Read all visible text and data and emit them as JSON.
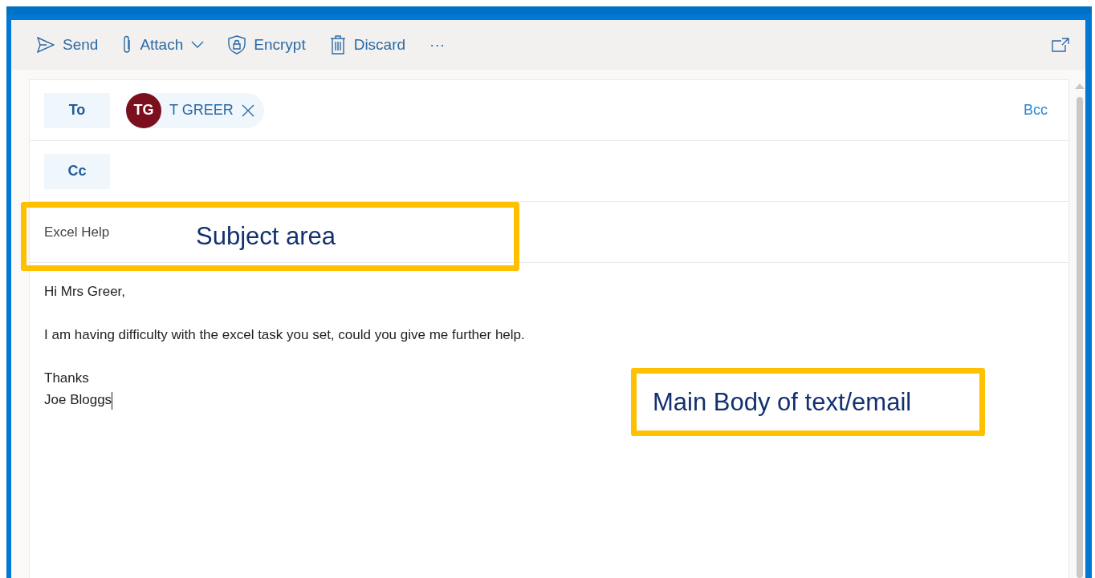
{
  "toolbar": {
    "actions": [
      {
        "kind": "send",
        "label": "Send"
      },
      {
        "kind": "attach",
        "label": "Attach",
        "dropdown": true
      },
      {
        "kind": "encrypt",
        "label": "Encrypt"
      },
      {
        "kind": "discard",
        "label": "Discard"
      },
      {
        "kind": "more",
        "label": "···"
      }
    ]
  },
  "recipients": {
    "to": {
      "label": "To",
      "contacts": [
        {
          "initials": "TG",
          "name": "T GREER",
          "color": "#7b0f1d"
        }
      ]
    },
    "bcc": "Bcc",
    "cc": {
      "label": "Cc"
    }
  },
  "subject": {
    "value": "Excel Help"
  },
  "body": {
    "paragraphs": [
      {
        "lines": [
          "Hi Mrs Greer,"
        ]
      },
      {
        "lines": [
          "I am having difficulty with the excel task you set, could you give me further help."
        ]
      },
      {
        "lines": [
          "Thanks",
          "Joe Bloggs"
        ]
      }
    ]
  },
  "annotations": [
    {
      "kind": "subject",
      "label": "Subject area"
    },
    {
      "kind": "body",
      "label": "Main Body of text/email"
    }
  ]
}
